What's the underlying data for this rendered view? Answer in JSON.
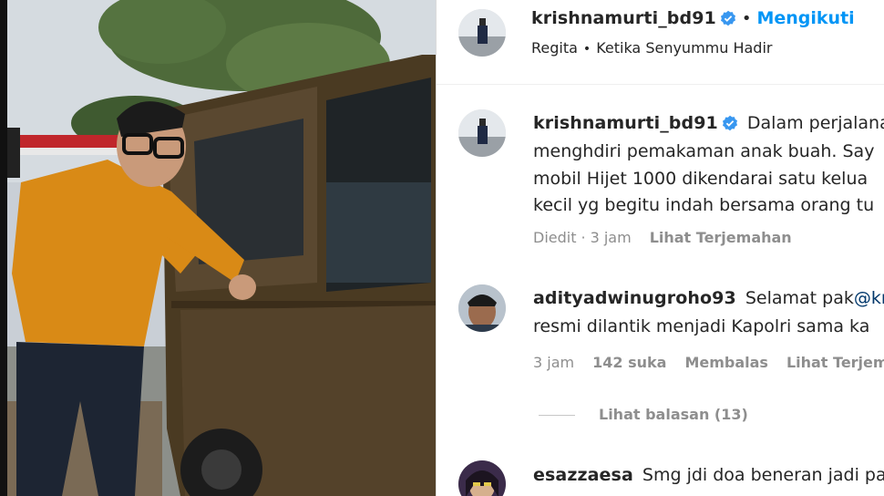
{
  "post": {
    "author": "krishnamurti_bd91",
    "follow_label": "Mengikuti",
    "subline": {
      "tag": "Regita",
      "song": "Ketika Senyummu Hadir"
    }
  },
  "caption": {
    "username": "krishnamurti_bd91",
    "lines": [
      "Dalam perjalana",
      "menghdiri pemakaman anak buah. Say",
      "mobil Hijet 1000 dikendarai satu kelua",
      "kecil yg begitu indah bersama orang tu"
    ],
    "edited": "Diedit",
    "time": "3 jam",
    "translate": "Lihat Terjemahan"
  },
  "comments": [
    {
      "username": "adityadwinugroho93",
      "text_line1": "Selamat pak",
      "mention": "@kr",
      "text_line2": "resmi dilantik menjadi Kapolri sama ka",
      "time": "3 jam",
      "likes": "142 suka",
      "reply": "Membalas",
      "translate": "Lihat Terjema",
      "view_replies": "Lihat balasan (13)"
    },
    {
      "username": "esazzaesa",
      "text_line1": "Smg jdi doa beneran jadi pa"
    }
  ],
  "icons": {
    "verified": "verified-badge-icon"
  },
  "colors": {
    "link_blue": "#0095f6",
    "verified_blue": "#3897f0",
    "muted": "#8e8e8e",
    "text": "#262626"
  }
}
